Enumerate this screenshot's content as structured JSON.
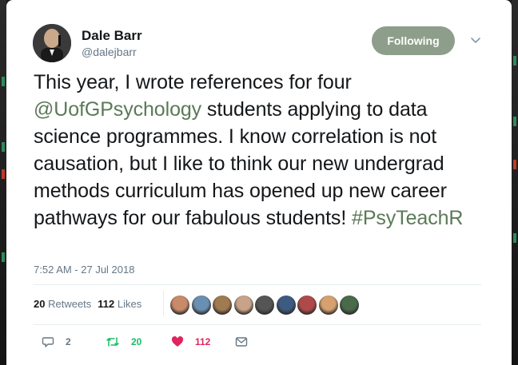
{
  "user": {
    "name": "Dale Barr",
    "handle": "@dalejbarr"
  },
  "follow_button": {
    "label": "Following"
  },
  "tweet": {
    "seg1": "This year, I wrote references for four ",
    "mention": "@UofGPsychology",
    "seg2": " students applying to data science programmes. I know correlation is not causation, but I like to think our new undergrad methods curriculum has opened up new career pathways for our fabulous students! ",
    "hashtag": "#PsyTeachR"
  },
  "timestamp": "7:52 AM - 27 Jul 2018",
  "stats": {
    "retweets_count": "20",
    "retweets_label": "Retweets",
    "likes_count": "112",
    "likes_label": "Likes"
  },
  "likers": [
    {
      "color": "#c98a6a"
    },
    {
      "color": "#6b8fb0"
    },
    {
      "color": "#a07a50"
    },
    {
      "color": "#c9a28a"
    },
    {
      "color": "#555555"
    },
    {
      "color": "#3d5a80"
    },
    {
      "color": "#b04a4a"
    },
    {
      "color": "#d6a070"
    },
    {
      "color": "#4a6a4a"
    }
  ],
  "actions": {
    "replies": "2",
    "retweets": "20",
    "likes": "112"
  },
  "colors": {
    "accent": "#5b7a57",
    "follow_bg": "#8d9e8a",
    "retweet": "#17bf63",
    "like": "#e0245e",
    "muted": "#657786"
  }
}
